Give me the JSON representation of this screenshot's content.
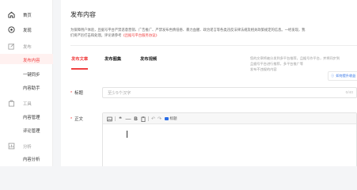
{
  "sidebar": {
    "home_label": "首页",
    "discover_label": "发现",
    "publish_label": "发布",
    "publish_items": [
      "发布内容",
      "一键同步",
      "内容助手"
    ],
    "tools_label": "工具",
    "tools_items": [
      "内容管理",
      "评论管理"
    ],
    "analytics_label": "分析",
    "analytics_items": [
      "内容分析"
    ]
  },
  "main": {
    "page_title": "发布内容",
    "notice_text": "为保障用户体验，且据号平台严禁恶意营销、广告推广、严禁发布色情低俗、暴力血腥、政治谣言等各类违反法律法规及相关政策规定的信息。一经发现，我们将严厉打击和处理。评论请参考",
    "notice_link": "《且据号平台服务协议》",
    "tabs": [
      "发布文章",
      "发布图集",
      "发布视频"
    ],
    "promo_lines": [
      "您的文章将被分发到多平台推荐，且据号作平台，并将同步到",
      "且据号平台进行推荐，多平台推广等",
      "发布不违规的内容"
    ],
    "promo_button": "如何提升收益",
    "form": {
      "title_label": "标题",
      "title_placeholder": "至少5个汉字",
      "title_count": "0/40",
      "body_label": "正文"
    },
    "toolbar": {
      "bold": "B",
      "checkbox_label": "标题"
    }
  },
  "colors": {
    "accent": "#f04142",
    "link_blue": "#2b6de5"
  }
}
